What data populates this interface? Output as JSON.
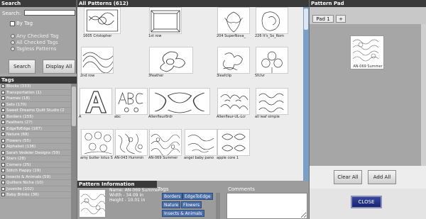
{
  "search": {
    "title": "Search",
    "label": "Search:",
    "value": "",
    "by_tag_label": "By Tag",
    "radios": [
      "Any Checked Tag",
      "All Checked Tags",
      "Tagless Patterns"
    ],
    "search_button": "Search",
    "display_all_button": "Display All"
  },
  "tags": {
    "title": "Tags",
    "items": [
      "Blocks (333)",
      "Transportation (1)",
      "Frames (18)",
      "Sets (170)",
      "Sweet Dreams Quilt Studio (2",
      "Borders (155)",
      "Feathers (27)",
      "EdgeToEdge (187)",
      "Nature (68)",
      "Flowers (55)",
      "Alphabet (136)",
      "Sarah Vedeler Designs (59)",
      "Stars (28)",
      "Corners (25)",
      "Stitch Happy (19)",
      "Insects & Animals (59)",
      "Quilters Niche (10)",
      "Juvenile (102)",
      "Baby Brinks (36)"
    ]
  },
  "patterns": {
    "title": "All Patterns (612)",
    "thumbnails": [
      "1605 Cristopher",
      "",
      "1st row",
      "",
      "204 SuperNova_",
      "226 It's_So_Rom",
      "",
      "",
      "2nd row",
      "",
      "3feather",
      "3leafclip",
      "5fclvr",
      "A",
      "abc",
      "",
      "Allenfleur8rdr",
      "",
      "Allenfleur-UL-Lcr",
      "all leaf simple",
      "amy butler lotus S",
      "AN-043 Hummin",
      "AN-069 Summer",
      "angel baby pano",
      "apple core 1",
      ""
    ]
  },
  "info": {
    "title": "Pattern Information",
    "name_line": "Name: AN-069 Summer",
    "width_line": "Width - 34.09 in",
    "height_line": "Height - 10.01 in",
    "tags_title": "Tags",
    "tag_pills": [
      "Borders",
      "EdgeToEdge",
      "Nature",
      "Flowers",
      "Insects & Animals"
    ],
    "comments_title": "Comments",
    "comments_value": ""
  },
  "pad": {
    "title": "Pattern Pad",
    "tab_label": "Pad 1",
    "tab_close": "x",
    "add_tab": "+",
    "item_caption": "AN-069 Summer",
    "clear_all": "Clear All",
    "add_all": "Add All",
    "close": "CLOSE"
  }
}
